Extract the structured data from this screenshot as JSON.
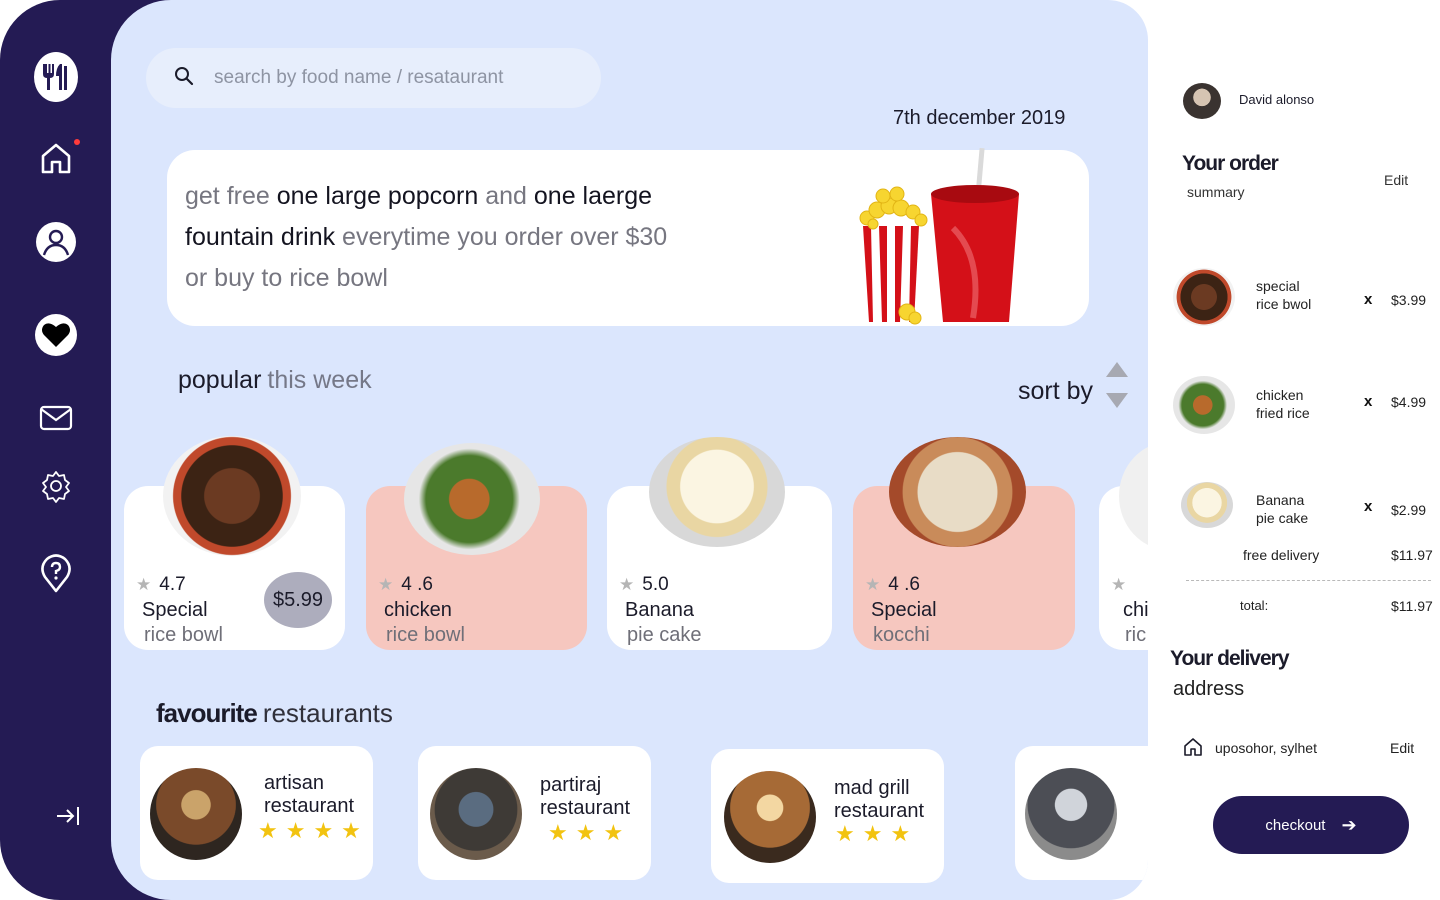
{
  "search": {
    "placeholder": "search by food name / resataurant"
  },
  "date": "7th december 2019",
  "promo": {
    "l1a": "get free ",
    "l1b": "one large popcorn",
    "l1c": " and ",
    "l1d": "one laerge",
    "l2a": "fountain drink",
    "l2b": " everytime you order over $30",
    "l3": "or buy to rice bowl"
  },
  "popular": {
    "title": "popular",
    "subtitle": "this week",
    "sort_label": "sort by"
  },
  "cards": [
    {
      "rating": "4.7",
      "name1": "Special",
      "name2": "rice bowl",
      "price": "$5.99",
      "highlight": false
    },
    {
      "rating": "4 .6",
      "name1": "chicken",
      "name2": "rice bowl",
      "highlight": true
    },
    {
      "rating": "5.0",
      "name1": "Banana",
      "name2": "pie cake",
      "highlight": false
    },
    {
      "rating": "4 .6",
      "name1": "Special",
      "name2": "kocchi",
      "highlight": true
    },
    {
      "rating": "",
      "name1": "chi",
      "name2": "ric",
      "highlight": false
    }
  ],
  "favourites": {
    "title_bold": "favourite",
    "title_light": "restaurants",
    "items": [
      {
        "line1": "artisan",
        "line2": "restaurant",
        "stars": "★★★★"
      },
      {
        "line1": "partiraj",
        "line2": "restaurant",
        "stars": "★★★"
      },
      {
        "line1": "mad grill",
        "line2": "restaurant",
        "stars": "★★★"
      },
      {
        "line1": "",
        "line2": "",
        "stars": ""
      }
    ]
  },
  "user": {
    "name": "David alonso"
  },
  "order": {
    "title": "Your order",
    "subtitle": "summary",
    "edit": "Edit",
    "items": [
      {
        "line1": "special",
        "line2": "rice bwol",
        "x": "x",
        "price": "$3.99"
      },
      {
        "line1": "chicken",
        "line2": "fried rice",
        "x": "x",
        "price": "$4.99"
      },
      {
        "line1": "Banana",
        "line2": "pie cake",
        "x": "x",
        "price": "$2.99"
      }
    ],
    "free_delivery_label": "free delivery",
    "free_delivery_value": "$11.97",
    "total_label": "total:",
    "total_value": "$11.97"
  },
  "delivery": {
    "title": "Your delivery",
    "subtitle": "address",
    "address": "uposohor, sylhet",
    "edit": "Edit"
  },
  "checkout": {
    "label": "checkout"
  },
  "colors": {
    "sidebar": "#241b54",
    "main_bg": "#dbe6fd",
    "card_highlight": "#f6c7bf",
    "star": "#f2c310"
  }
}
